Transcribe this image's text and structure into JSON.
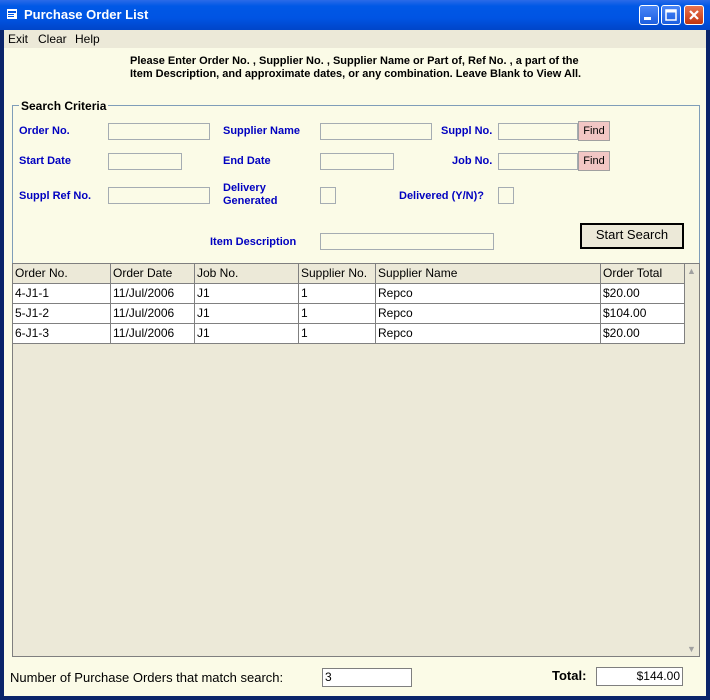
{
  "window": {
    "title": "Purchase Order List"
  },
  "menu": {
    "exit": "Exit",
    "clear": "Clear",
    "help": "Help"
  },
  "instructions": "Please Enter Order No. , Supplier No. , Supplier Name or Part of, Ref No. , a part of the Item Description, and approximate dates, or any combination. Leave Blank to View All.",
  "search": {
    "group_title": "Search Criteria",
    "order_no_label": "Order No.",
    "supplier_name_label": "Supplier Name",
    "suppl_no_label": "Suppl No.",
    "start_date_label": "Start Date",
    "end_date_label": "End Date",
    "job_no_label": "Job No.",
    "suppl_ref_label": "Suppl Ref No.",
    "delivery_generated_label_1": "Delivery",
    "delivery_generated_label_2": "Generated",
    "delivered_label": "Delivered (Y/N)?",
    "item_description_label": "Item Description",
    "find_label": "Find",
    "start_search_label": "Start Search"
  },
  "grid": {
    "headers": [
      "Order No.",
      "Order Date",
      "Job No.",
      "Supplier No.",
      "Supplier Name",
      "Order Total"
    ],
    "rows": [
      [
        "4-J1-1",
        "11/Jul/2006",
        "J1",
        "1",
        "Repco",
        "$20.00"
      ],
      [
        "5-J1-2",
        "11/Jul/2006",
        "J1",
        "1",
        "Repco",
        "$104.00"
      ],
      [
        "6-J1-3",
        "11/Jul/2006",
        "J1",
        "1",
        "Repco",
        "$20.00"
      ]
    ]
  },
  "footer": {
    "match_label": "Number of Purchase Orders that match search:",
    "match_count": "3",
    "total_label": "Total:",
    "total_value": "$144.00"
  }
}
